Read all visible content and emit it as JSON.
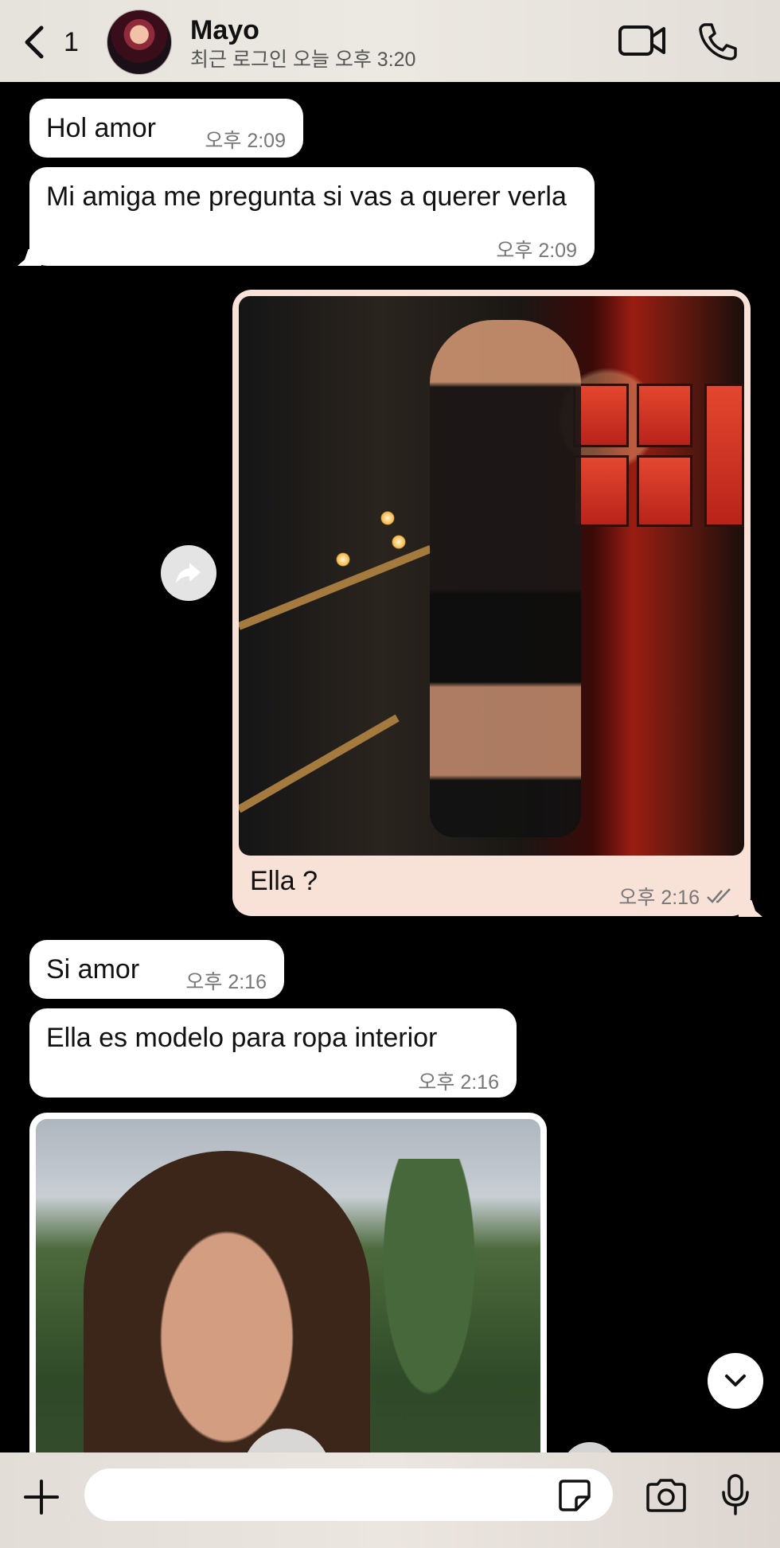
{
  "header": {
    "back_count": "1",
    "contact_name": "Mayo",
    "last_seen": "최근 로그인 오늘 오후 3:20"
  },
  "messages": [
    {
      "direction": "incoming",
      "text": "Hol amor",
      "time": "오후 2:09"
    },
    {
      "direction": "incoming",
      "text": "Mi amiga me pregunta si vas a querer verla",
      "time": "오후 2:09"
    },
    {
      "direction": "outgoing",
      "type": "photo",
      "caption": "Ella ?",
      "time": "오후 2:16",
      "status": "read"
    },
    {
      "direction": "incoming",
      "text": "Si amor",
      "time": "오후 2:16"
    },
    {
      "direction": "incoming",
      "text": "Ella es modelo para ropa interior",
      "time": "오후 2:16"
    },
    {
      "direction": "incoming",
      "type": "photo"
    }
  ],
  "input": {
    "placeholder": ""
  },
  "icons": {
    "back": "chevron-left-icon",
    "video": "video-camera-icon",
    "call": "phone-icon",
    "share": "share-arrow-icon",
    "scroll": "chevron-down-icon",
    "plus": "plus-icon",
    "sticker": "sticker-icon",
    "camera": "camera-icon",
    "mic": "microphone-icon"
  },
  "colors": {
    "background": "#000000",
    "incoming_bubble": "#ffffff",
    "outgoing_bubble": "#f8e2d8",
    "header_bar": "#e8e4de"
  }
}
